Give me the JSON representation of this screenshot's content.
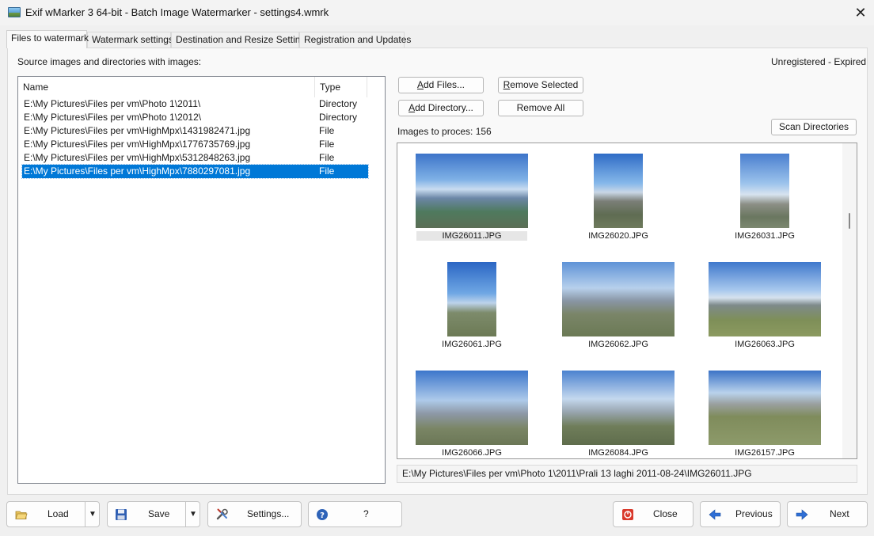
{
  "window": {
    "title": "Exif wMarker 3 64-bit - Batch Image Watermarker - settings4.wmrk",
    "close_glyph": "✕"
  },
  "tabs": [
    {
      "label": "Files to watermark"
    },
    {
      "label": "Watermark settings"
    },
    {
      "label": "Destination and Resize Settings"
    },
    {
      "label": "Registration and Updates"
    }
  ],
  "files_panel": {
    "heading": "Source images and directories with images:",
    "license_status": "Unregistered - Expired",
    "columns": {
      "name": "Name",
      "type": "Type"
    },
    "rows": [
      {
        "name": "E:\\My Pictures\\Files per vm\\Photo 1\\2011\\",
        "type": "Directory"
      },
      {
        "name": "E:\\My Pictures\\Files per vm\\Photo 1\\2012\\",
        "type": "Directory"
      },
      {
        "name": "E:\\My Pictures\\Files per vm\\HighMpx\\1431982471.jpg",
        "type": "File"
      },
      {
        "name": "E:\\My Pictures\\Files per vm\\HighMpx\\1776735769.jpg",
        "type": "File"
      },
      {
        "name": "E:\\My Pictures\\Files per vm\\HighMpx\\5312848263.jpg",
        "type": "File"
      },
      {
        "name": "E:\\My Pictures\\Files per vm\\HighMpx\\7880297081.jpg",
        "type": "File",
        "selected": true
      }
    ]
  },
  "actions": {
    "add_files": {
      "key": "A",
      "rest": "dd Files..."
    },
    "remove_selected": {
      "key": "R",
      "rest": "emove Selected"
    },
    "add_directory": {
      "key": "A",
      "rest": "dd Directory..."
    },
    "remove_all": "Remove All",
    "scan_directories": "Scan Directories"
  },
  "images": {
    "count_text": "Images to proces: 156",
    "thumbnails": [
      {
        "caption": "IMG26011.JPG",
        "orientation": "landscape",
        "selected": true
      },
      {
        "caption": "IMG26020.JPG",
        "orientation": "portrait"
      },
      {
        "caption": "IMG26031.JPG",
        "orientation": "portrait"
      },
      {
        "caption": "IMG26061.JPG",
        "orientation": "portrait"
      },
      {
        "caption": "IMG26062.JPG",
        "orientation": "landscape"
      },
      {
        "caption": "IMG26063.JPG",
        "orientation": "landscape"
      },
      {
        "caption": "IMG26066.JPG",
        "orientation": "landscape"
      },
      {
        "caption": "IMG26084.JPG",
        "orientation": "landscape"
      },
      {
        "caption": "IMG26157.JPG",
        "orientation": "landscape"
      }
    ],
    "current_path": "E:\\My Pictures\\Files per vm\\Photo 1\\2011\\Prali 13 laghi 2011-08-24\\IMG26011.JPG"
  },
  "bottom_bar": {
    "load": "Load",
    "save": "Save",
    "settings": "Settings...",
    "help": "?",
    "close": "Close",
    "previous": "Previous",
    "next": "Next"
  },
  "colors": {
    "selection": "#0078d7",
    "accent_arrow": "#2f6fd6"
  }
}
